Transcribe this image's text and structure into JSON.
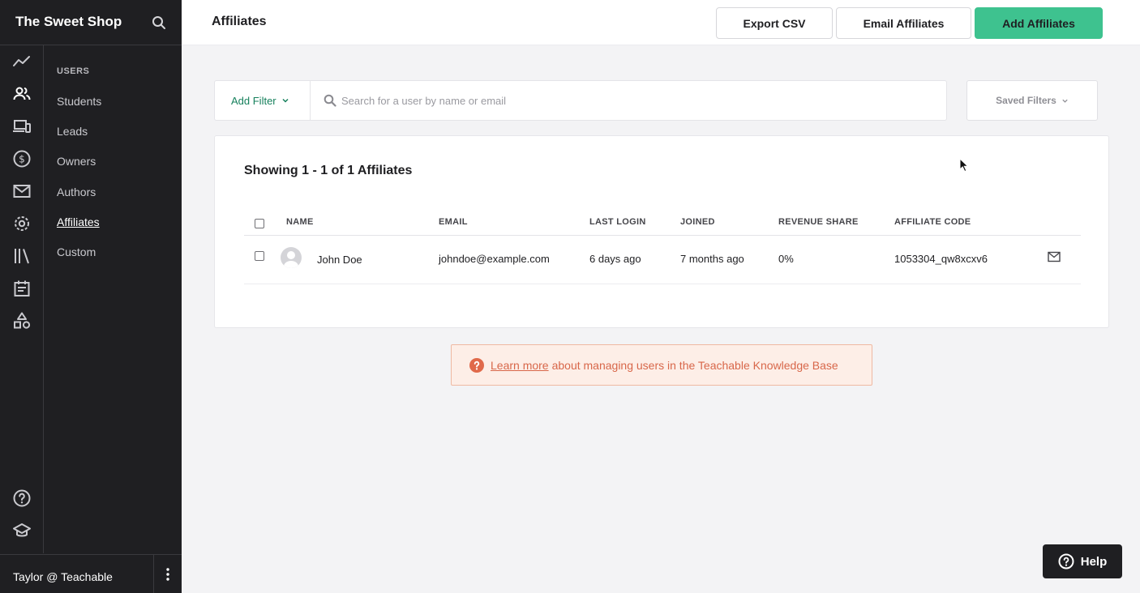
{
  "sidebar": {
    "brand": "The Sweet Shop",
    "section_heading": "USERS",
    "items": [
      {
        "label": "Students"
      },
      {
        "label": "Leads"
      },
      {
        "label": "Owners"
      },
      {
        "label": "Authors"
      },
      {
        "label": "Affiliates",
        "active": true
      },
      {
        "label": "Custom"
      }
    ],
    "rail_icons": [
      "analytics-icon",
      "users-icon",
      "sites-icon",
      "sales-icon",
      "email-icon",
      "settings-icon",
      "library-icon",
      "calendar-icon",
      "shapes-icon",
      "help-circle-icon",
      "academy-icon"
    ],
    "user": "Taylor @ Teachable"
  },
  "header": {
    "title": "Affiliates",
    "export_label": "Export CSV",
    "email_label": "Email Affiliates",
    "add_label": "Add Affiliates"
  },
  "filters": {
    "add_filter_label": "Add Filter",
    "search_placeholder": "Search for a user by name or email",
    "saved_filters_label": "Saved Filters"
  },
  "table": {
    "showing_text": "Showing 1 - 1 of 1 Affiliates",
    "columns": [
      "NAME",
      "EMAIL",
      "LAST LOGIN",
      "JOINED",
      "REVENUE SHARE",
      "AFFILIATE CODE"
    ],
    "rows": [
      {
        "name": "John Doe",
        "email": "johndoe@example.com",
        "last_login": "6 days ago",
        "joined": "7 months ago",
        "revenue_share": "0%",
        "affiliate_code": "1053304_qw8xcxv6"
      }
    ]
  },
  "banner": {
    "link_text": "Learn more",
    "text": "about managing users in the Teachable Knowledge Base"
  },
  "help": {
    "label": "Help"
  },
  "colors": {
    "accent": "#3ec28f",
    "sidebar_bg": "#1f1f22",
    "link_green": "#16805c",
    "banner_text": "#d8674a"
  }
}
